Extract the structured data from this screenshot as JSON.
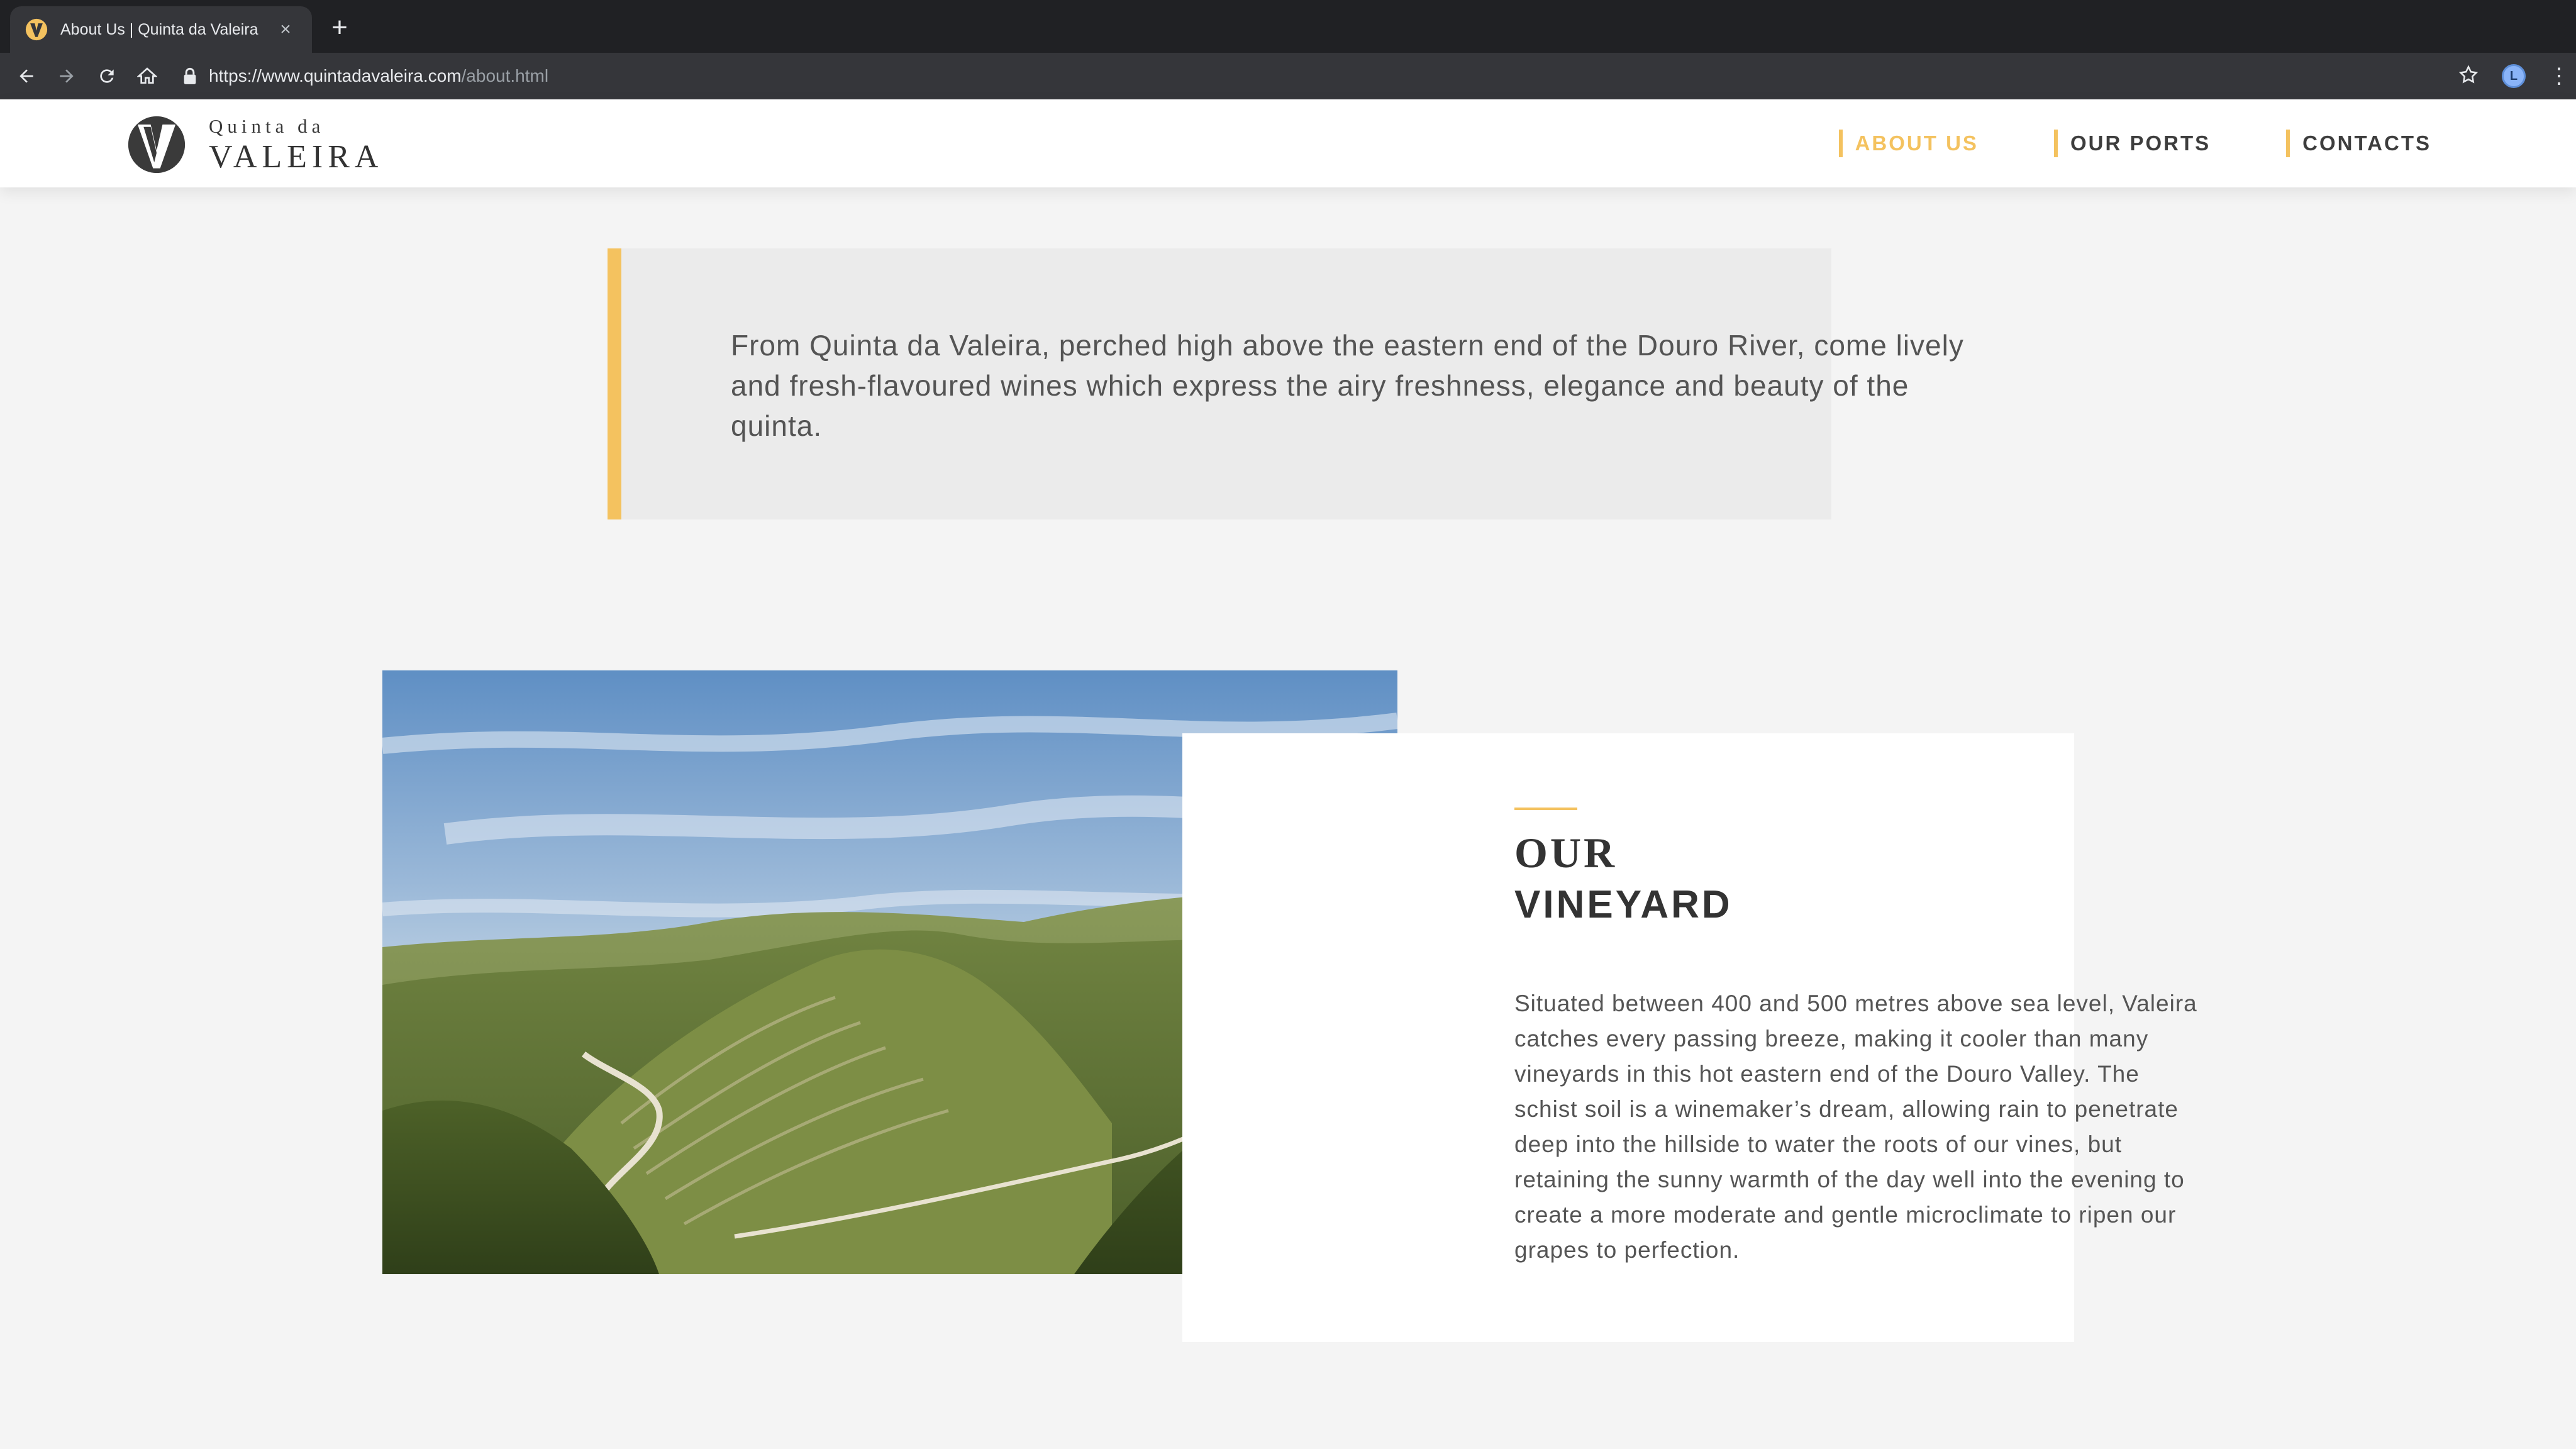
{
  "browser": {
    "tab_title": "About Us | Quinta da Valeira",
    "tab_close": "×",
    "new_tab": "+",
    "url_domain": "https://www.quintadavaleira.com",
    "url_path": "/about.html",
    "profile_initial": "L",
    "menu": "⋮"
  },
  "site": {
    "logo_top": "Quinta da",
    "logo_bottom": "VALEIRA",
    "nav": [
      {
        "label": "ABOUT US",
        "active": true
      },
      {
        "label": "OUR PORTS",
        "active": false
      },
      {
        "label": "CONTACTS",
        "active": false
      }
    ]
  },
  "quote": {
    "text": "From Quinta da Valeira, perched high above the eastern end of the Douro River, come lively and fresh-flavoured wines which express the airy freshness, elegance and beauty of the quinta."
  },
  "vineyard": {
    "title_line1": "OUR",
    "title_line2": "VINEYARD",
    "body": "Situated between 400 and 500 metres above sea level, Valeira catches every passing breeze, making it cooler than many vineyards in this hot eastern end of the Douro Valley. The schist soil is a winemaker’s dream, allowing rain to penetrate deep into the hillside to water the roots of our vines, but retaining the sunny warmth of the day well into the evening to create a more moderate and gentle microclimate to ripen our grapes to perfection."
  },
  "colors": {
    "accent": "#f4c25f",
    "background": "#f4f4f4",
    "quote_bg": "#ebebeb",
    "text": "#545454"
  }
}
